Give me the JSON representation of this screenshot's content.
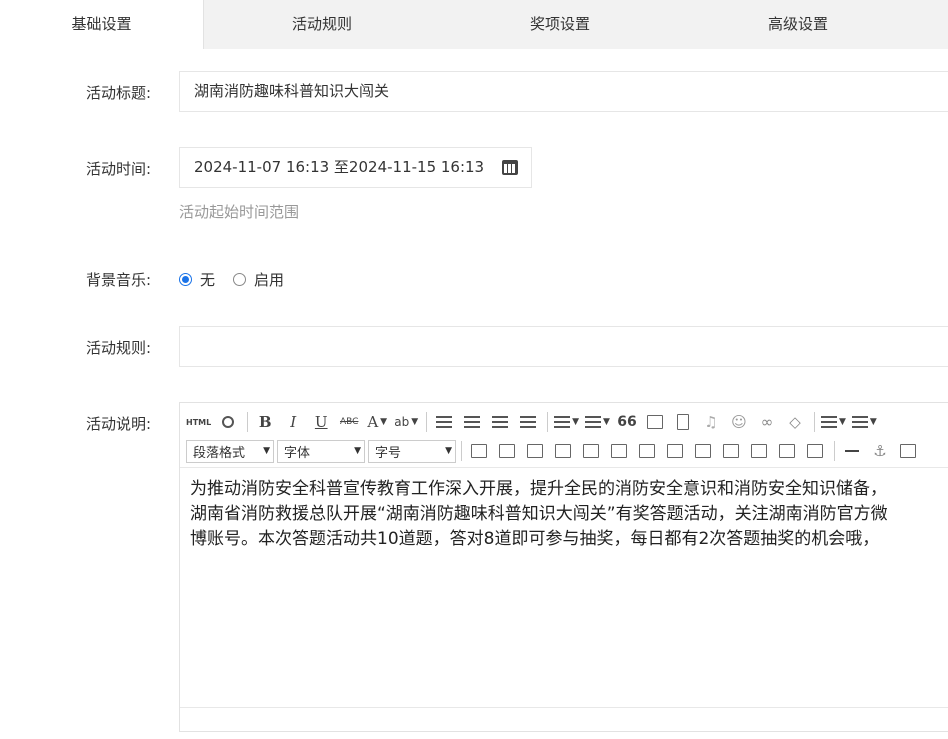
{
  "tabs": [
    {
      "label": "基础设置",
      "active": true
    },
    {
      "label": "活动规则",
      "active": false
    },
    {
      "label": "奖项设置",
      "active": false
    },
    {
      "label": "高级设置",
      "active": false
    }
  ],
  "form": {
    "title_label": "活动标题:",
    "title_value": "湖南消防趣味科普知识大闯关",
    "time_label": "活动时间:",
    "time_value": "2024-11-07 16:13 至2024-11-15 16:13",
    "time_hint": "活动起始时间范围",
    "music_label": "背景音乐:",
    "music_options": [
      {
        "label": "无",
        "checked": true
      },
      {
        "label": "启用",
        "checked": false
      }
    ],
    "rules_label": "活动规则:",
    "rules_value": "",
    "desc_label": "活动说明:"
  },
  "editor": {
    "html_btn": "HTML",
    "bold": "B",
    "italic": "I",
    "underline": "U",
    "strike": "ABC",
    "font_color": "A",
    "bg_color": "ab",
    "quote": "66",
    "paragraph_select": "段落格式",
    "font_select": "字体",
    "size_select": "字号",
    "content_lines": [
      "为推动消防安全科普宣传教育工作深入开展，提升全民的消防安全意识和消防安全知识储备，",
      "湖南省消防救援总队开展“湖南消防趣味科普知识大闯关”有奖答题活动，关注湖南消防官方微",
      "博账号。本次答题活动共10道题，答对8道即可参与抽奖，每日都有2次答题抽奖的机会哦，"
    ]
  }
}
